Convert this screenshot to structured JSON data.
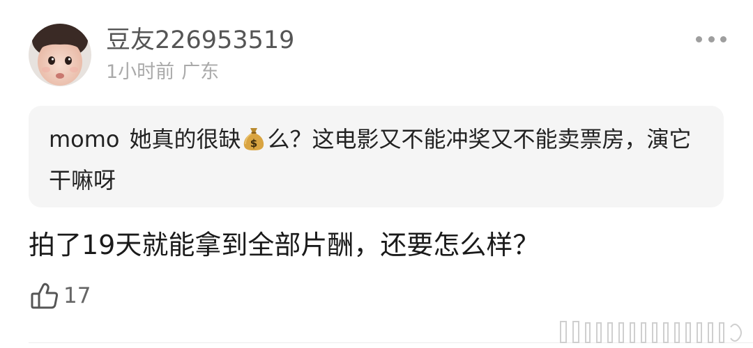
{
  "comment": {
    "username": "豆友226953519",
    "time": "1小时前",
    "location": "广东",
    "quote": {
      "username": "momo",
      "text_before_emoji": "她真的很缺",
      "emoji": "money-bag-icon",
      "text_after_emoji": "么？这电影又不能冲奖又不能卖票房，演它干嘛呀"
    },
    "body": "拍了19天就能拿到全部片酬，还要怎么样？",
    "like_count": "17"
  }
}
